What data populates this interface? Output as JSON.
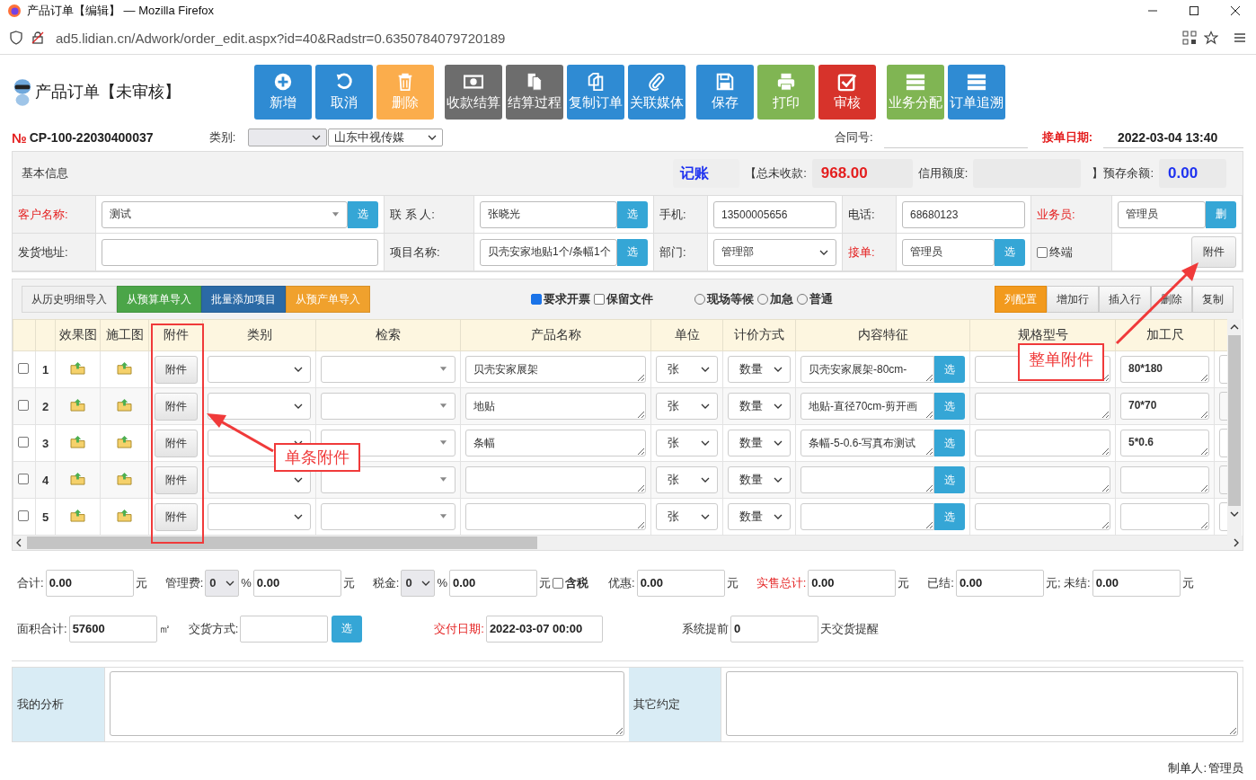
{
  "browser": {
    "title": "产品订单【编辑】 — Mozilla Firefox",
    "url": "ad5.lidian.cn/Adwork/order_edit.aspx?id=40&Radstr=0.6350784079720189"
  },
  "header": {
    "title": "产品订单【未审核】",
    "toolbar": [
      [
        {
          "label": "新增",
          "color": "#2f8bd3"
        },
        {
          "label": "取消",
          "color": "#2f8bd3"
        },
        {
          "label": "删除",
          "color": "#fbad4c"
        }
      ],
      [
        {
          "label": "收款结算",
          "color": "#6d6d6d"
        },
        {
          "label": "结算过程",
          "color": "#6d6d6d"
        },
        {
          "label": "复制订单",
          "color": "#2f8bd3"
        },
        {
          "label": "关联媒体",
          "color": "#2f8bd3"
        }
      ],
      [
        {
          "label": "保存",
          "color": "#2f8bd3"
        },
        {
          "label": "打印",
          "color": "#80b553"
        },
        {
          "label": "审核",
          "color": "#d7332b"
        }
      ],
      [
        {
          "label": "业务分配",
          "color": "#80b553"
        },
        {
          "label": "订单追溯",
          "color": "#2f8bd3"
        }
      ]
    ]
  },
  "order": {
    "no_mark": "№",
    "number": "CP-100-22030400037",
    "category_label": "类别:",
    "company": "山东中视传媒",
    "contract_label": "合同号:",
    "date_label": "接单日期:",
    "date": "2022-03-04 13:40"
  },
  "basic": {
    "title": "基本信息",
    "account": "记账",
    "unpaid_label": "【总未收款:",
    "unpaid": "968.00",
    "credit_label": "信用额度:",
    "prepaid_label": "】预存余额:",
    "prepaid": "0.00"
  },
  "fields": [
    [
      {
        "label": "客户名称:",
        "required": true,
        "kind": "combo",
        "value": "测试",
        "button": "选"
      },
      {
        "label": "联 系 人:",
        "required": false,
        "kind": "pick",
        "value": "张晓光",
        "button": "选"
      },
      {
        "label": "手机:",
        "required": false,
        "kind": "input",
        "value": "13500005656"
      },
      {
        "label": "电话:",
        "required": false,
        "kind": "input",
        "value": "68680123"
      },
      {
        "label": "业务员:",
        "required": true,
        "kind": "pick",
        "value": "管理员",
        "button": "删"
      }
    ],
    [
      {
        "label": "发货地址:",
        "required": false,
        "kind": "input"
      },
      {
        "label": "项目名称:",
        "required": false,
        "kind": "pick",
        "value": "贝壳安家地贴1个/条幅1个",
        "button": "选"
      },
      {
        "label": "部门:",
        "required": false,
        "kind": "select",
        "value": "管理部"
      },
      {
        "label": "接单:",
        "required": true,
        "kind": "pick",
        "value": "管理员",
        "button": "选"
      },
      {
        "label": "终端",
        "kind": "checkbox",
        "checked": false,
        "button": "附件"
      }
    ]
  ],
  "imports": [
    {
      "label": "从历史明细导入",
      "color": "#f0f0f0"
    },
    {
      "label": "从预算单导入",
      "color": "#4ba548"
    },
    {
      "label": "批量添加项目",
      "color": "#2b6aa6"
    },
    {
      "label": "从预产单导入",
      "color": "#f0a12d"
    }
  ],
  "options": [
    {
      "label": "要求开票",
      "checked": true
    },
    {
      "label": "保留文件",
      "checked": false
    }
  ],
  "priority": [
    {
      "label": "现场等候",
      "selected": false
    },
    {
      "label": "加急",
      "selected": false
    },
    {
      "label": "普通",
      "selected": false
    }
  ],
  "row_actions": [
    {
      "label": "列配置",
      "selected": true
    },
    {
      "label": "增加行",
      "selected": false
    },
    {
      "label": "插入行",
      "selected": false
    },
    {
      "label": "删除",
      "selected": false
    },
    {
      "label": "复制",
      "selected": false
    }
  ],
  "table": {
    "columns": [
      "效果图",
      "施工图",
      "附件",
      "类别",
      "检索",
      "产品名称",
      "单位",
      "计价方式",
      "内容特征",
      "规格型号",
      "加工尺"
    ],
    "rows": [
      {
        "checked": false,
        "no": "1",
        "attach": "附件",
        "product": "贝壳安家展架",
        "unit": "张",
        "pricing": "数量",
        "content": "贝壳安家展架-80cm-",
        "pick": "选",
        "size": "80*180"
      },
      {
        "checked": false,
        "no": "2",
        "attach": "附件",
        "product": "地贴",
        "unit": "张",
        "pricing": "数量",
        "content": "地贴-直径70cm-剪开画",
        "pick": "选",
        "size": "70*70"
      },
      {
        "checked": false,
        "no": "3",
        "attach": "附件",
        "product": "条幅",
        "unit": "张",
        "pricing": "数量",
        "content": "条幅-5-0.6-写真布测试",
        "pick": "选",
        "size": "5*0.6"
      },
      {
        "checked": false,
        "no": "4",
        "attach": "附件",
        "unit": "张",
        "pricing": "数量",
        "pick": "选"
      },
      {
        "checked": false,
        "no": "5",
        "attach": "附件",
        "unit": "张",
        "pricing": "数量",
        "pick": "选"
      }
    ]
  },
  "totals": [
    [
      {
        "kind": "label",
        "text": "合计:",
        "required": false
      },
      {
        "kind": "input",
        "text": "0.00"
      },
      {
        "kind": "unit",
        "text": "元"
      },
      {
        "kind": "label",
        "text": "管理费:",
        "required": false
      },
      {
        "kind": "select",
        "text": "0"
      },
      {
        "kind": "unit",
        "text": "%"
      },
      {
        "kind": "input",
        "text": "0.00"
      },
      {
        "kind": "unit",
        "text": "元"
      },
      {
        "kind": "label",
        "text": "税金:",
        "required": false
      },
      {
        "kind": "select",
        "text": "0"
      },
      {
        "kind": "unit",
        "text": "%"
      },
      {
        "kind": "input",
        "text": "0.00"
      },
      {
        "kind": "unit",
        "text": "元"
      },
      {
        "kind": "check",
        "text": "含税",
        "checked": false
      },
      {
        "kind": "label",
        "text": "优惠:",
        "required": false
      },
      {
        "kind": "input",
        "text": "0.00"
      },
      {
        "kind": "unit",
        "text": "元"
      },
      {
        "kind": "label",
        "text": "实售总计:",
        "required": true
      },
      {
        "kind": "input",
        "text": "0.00"
      },
      {
        "kind": "unit",
        "text": "元"
      },
      {
        "kind": "label",
        "text": "已结:",
        "required": false
      },
      {
        "kind": "input",
        "text": "0.00"
      },
      {
        "kind": "unit",
        "text": "元; 未结:"
      },
      {
        "kind": "input",
        "text": "0.00"
      },
      {
        "kind": "unit",
        "text": "元"
      }
    ],
    [
      {
        "kind": "label",
        "text": "面积合计:",
        "required": false
      },
      {
        "kind": "input",
        "text": "57600"
      },
      {
        "kind": "unit",
        "text": "㎡"
      },
      {
        "kind": "label",
        "text": "交货方式:",
        "required": false
      },
      {
        "kind": "input"
      },
      {
        "kind": "pick",
        "text": "选"
      },
      {
        "kind": "label",
        "text": "交付日期:",
        "required": true
      },
      {
        "kind": "input",
        "text": "2022-03-07 00:00"
      },
      {
        "kind": "label",
        "text": "系统提前",
        "required": false
      },
      {
        "kind": "input",
        "text": "0"
      },
      {
        "kind": "unit",
        "text": "天交货提醒"
      }
    ]
  ],
  "notes": [
    {
      "label": "我的分析"
    },
    {
      "label": "其它约定"
    }
  ],
  "footer": {
    "maker_label": "制单人:",
    "maker": "管理员"
  },
  "annotations": [
    {
      "text": "单条附件"
    },
    {
      "text": "整单附件"
    }
  ]
}
